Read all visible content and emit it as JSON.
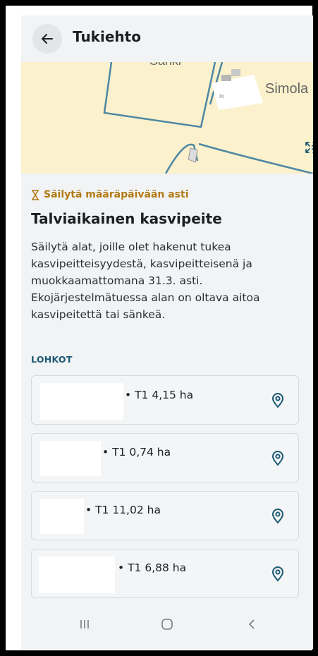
{
  "header": {
    "title": "Tukiehto"
  },
  "map": {
    "labels": [
      "Sänki",
      "Simola"
    ]
  },
  "deadline": {
    "text": "Säilytä määräpäivään asti"
  },
  "heading": "Talviaikainen kasvipeite",
  "description": "Säilytä alat, joille olet hakenut tukea kasvipeitteisyydestä, kasvipeitteisenä ja muokkaamattomana 31.3. asti. Ekojärjestelmätuessa alan on oltava aitoa kasvipeitettä tai sänkeä.",
  "section_label": "LOHKOT",
  "parcels": [
    {
      "text": "• T1 4,15 ha"
    },
    {
      "text": "• T1 0,74 ha"
    },
    {
      "text": "• T1 11,02 ha"
    },
    {
      "text": "• T1 6,88 ha"
    }
  ],
  "colors": {
    "accent": "#1c5973",
    "warning": "#b27a12",
    "map_bg": "#fbf1cc",
    "map_line": "#4d87a3"
  }
}
